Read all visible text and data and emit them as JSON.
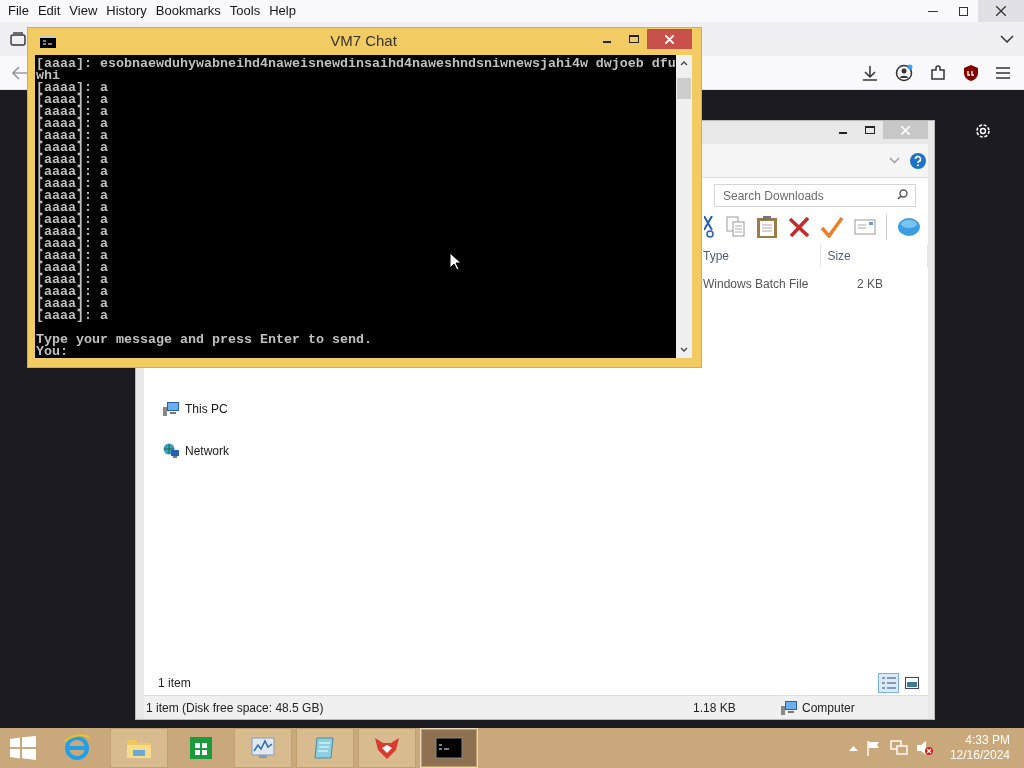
{
  "browser": {
    "menu": [
      "File",
      "Edit",
      "View",
      "History",
      "Bookmarks",
      "Tools",
      "Help"
    ]
  },
  "explorer": {
    "search": {
      "placeholder": "Search Downloads"
    },
    "columns": [
      "Type",
      "Size"
    ],
    "rows": [
      {
        "type": "Windows Batch File",
        "size": "2 KB"
      }
    ],
    "nav_items": [
      {
        "kind": "pc",
        "label": "This PC"
      },
      {
        "kind": "network",
        "label": "Network"
      }
    ],
    "item_count": "1 item",
    "status_bar": {
      "summary": "1 item (Disk free space: 48.5 GB)",
      "size": "1.18 KB",
      "zone": "Computer"
    }
  },
  "console": {
    "title": "VM7 Chat",
    "lines": [
      "[aaaa]: esobnaewduhywabneihd4naweisnewdinsaihd4naweshndsniwnewsjahi4w dwjoeb dfu",
      "whi",
      "[aaaa]: a",
      "[aaaa]: a",
      "[aaaa]: a",
      "[aaaa]: a",
      "[aaaa]: a",
      "[aaaa]: a",
      "[aaaa]: a",
      "[aaaa]: a",
      "[aaaa]: a",
      "[aaaa]: a",
      "[aaaa]: a",
      "[aaaa]: a",
      "[aaaa]: a",
      "[aaaa]: a",
      "[aaaa]: a",
      "[aaaa]: a",
      "[aaaa]: a",
      "[aaaa]: a",
      "[aaaa]: a",
      "[aaaa]: a"
    ],
    "prompt": [
      "Type your message and press Enter to send.",
      "You:"
    ]
  },
  "taskbar": {
    "apps": [
      {
        "kind": "ie",
        "running": false,
        "selected": false
      },
      {
        "kind": "explorer",
        "running": true,
        "selected": false
      },
      {
        "kind": "store",
        "running": false,
        "selected": false
      },
      {
        "kind": "monitor",
        "running": true,
        "selected": false
      },
      {
        "kind": "notepad",
        "running": true,
        "selected": false
      },
      {
        "kind": "fox",
        "running": true,
        "selected": false
      },
      {
        "kind": "console",
        "running": true,
        "selected": true
      }
    ],
    "time": "4:33 PM",
    "date": "12/16/2024"
  }
}
